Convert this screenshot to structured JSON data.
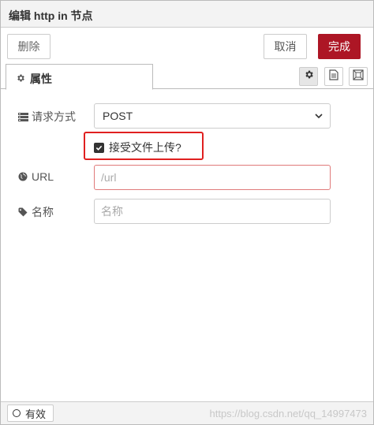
{
  "title": "编辑 http in 节点",
  "toolbar": {
    "delete_label": "删除",
    "cancel_label": "取消",
    "done_label": "完成"
  },
  "tabs": {
    "properties_label": "属性"
  },
  "form": {
    "method": {
      "label": "请求方式",
      "selected": "POST"
    },
    "upload": {
      "label": "接受文件上传?",
      "checked": true
    },
    "url": {
      "label": "URL",
      "value": "",
      "placeholder": "/url"
    },
    "name": {
      "label": "名称",
      "value": "",
      "placeholder": "名称"
    }
  },
  "footer": {
    "valid_label": "有效",
    "watermark": "https://blog.csdn.net/qq_14997473"
  },
  "colors": {
    "primary": "#ad1625",
    "highlight": "#e02020",
    "error_border": "#e07a7a"
  }
}
